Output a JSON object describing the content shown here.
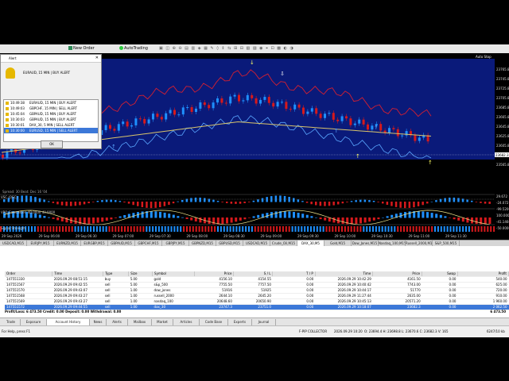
{
  "toolbar": {
    "new_order": "New Order",
    "auto_trading": "AutoTrading"
  },
  "alert": {
    "title": "Alert",
    "message": "EURAUD, 15 MIN | BUY ALERT",
    "items": [
      {
        "time": "10:49:38",
        "text": "EURAUD, 15 MIN | BUY ALERT"
      },
      {
        "time": "10:49:03",
        "text": "GBPCHF, 15 MIN | SELL ALERT"
      },
      {
        "time": "10:45:04",
        "text": "GBPAUD, 15 MIN | BUY ALERT"
      },
      {
        "time": "10:30:03",
        "text": "GBPAUD, 15 MIN | BUY ALERT"
      },
      {
        "time": "10:30:01",
        "text": "DAX_30, 5 MIN | SELL ALERT"
      },
      {
        "time": "10:30:00",
        "text": "EURUSD, 15 MIN | SELL ALERT"
      }
    ],
    "ok": "OK"
  },
  "chart": {
    "auto_stop": "Auto Stop",
    "spread_text": "Spread: 30  Beat: Dec 16 '04",
    "indicator1": "VSC (OSC)",
    "indicator2": "VPO_Forecaster: 40.0000 40.0000",
    "indicator3": "Signal Strength",
    "price_labels": [
      "23765.8",
      "23745.8",
      "23725.8",
      "23705.8",
      "23685.8",
      "23665.8",
      "23645.8",
      "23625.8",
      "23605.8",
      "23585.8",
      "23565.8"
    ],
    "osc_labels": [
      "29.672",
      "-24.072",
      "-99.5200",
      "100.000",
      "-41.1460",
      "-50.0000"
    ],
    "time_labels": [
      "29 Sep 2026",
      "29 Sep 06:00",
      "29 Sep 06:30",
      "29 Sep 07:00",
      "29 Sep 07:30",
      "29 Sep 08:00",
      "29 Sep 08:30",
      "29 Sep 09:00",
      "29 Sep 09:30",
      "29 Sep 10:00",
      "29 Sep 10:30",
      "29 Sep 11:00",
      "29 Sep 11:30"
    ],
    "current_price": "23682.3"
  },
  "symbol_tabs": [
    "USDCAD,M15",
    "EURJPY,M15",
    "EURNZD,M15",
    "EURGBP,M15",
    "GBPAUD,M15",
    "GBPCHF,M15",
    "GBPJPY,M15",
    "GBPNZD,M15",
    "GBPUSD,M15",
    "USDCAD,M15",
    "Crude_Oil,M15",
    "DAX_30,M5",
    "Gold,M15",
    "Dow_Jones,M15",
    "Nasdaq_100,M15",
    "Russell_2000,M15",
    "S&P_500,M15"
  ],
  "orders": {
    "columns": [
      "Order",
      "Time",
      "Type",
      "Size",
      "Symbol",
      "Price",
      "S / L",
      "T / P",
      "Time",
      "Price",
      "Swap",
      "Profit"
    ],
    "rows": [
      [
        "147551330",
        "2026.09.29 08:51:15",
        "buy",
        "5.00",
        "gold",
        "4156.10",
        "4154.55",
        "0.00",
        "2026.09.29 10:42:29",
        "4161.50",
        "0.00",
        "540.00"
      ],
      [
        "147551567",
        "2026.09.29 09:42:55",
        "sell",
        "5.00",
        "s&p_500",
        "7755.50",
        "7757.50",
        "0.00",
        "2026.09.29 10:40:42",
        "7743.00",
        "0.00",
        "625.00"
      ],
      [
        "147551570",
        "2026.09.29 09:43:07",
        "sell",
        "1.00",
        "dow_jones",
        "51916",
        "51925",
        "0.00",
        "2026.09.29 10:44:17",
        "51770",
        "0.00",
        "720.00"
      ],
      [
        "147551568",
        "2026.09.29 09:43:27",
        "sell",
        "1.00",
        "russell_2000",
        "2644.10",
        "2645.20",
        "0.00",
        "2026.09.29 11:27:44",
        "2635.00",
        "0.00",
        "910.00"
      ],
      [
        "147551569",
        "2026.09.29 09:43:27",
        "sell",
        "1.00",
        "nasdaq_100",
        "20648.60",
        "20650.90",
        "0.00",
        "2026.09.29 10:45:13",
        "20571.20",
        "0.00",
        "1 960.00"
      ],
      [
        "147551572",
        "2026.09.29 09:44:55",
        "sell",
        "1.00",
        "dax_30",
        "23747.3",
        "23751.0",
        "0.00",
        "2026.09.29 10:18:07",
        "23682.3",
        "0.00",
        "2 062.50"
      ]
    ],
    "summary": "Profit/Loss: 6 473.50  Credit: 0.00  Deposit: 0.00  Withdrawal: 0.00",
    "summary_total": "6 473.50"
  },
  "bottom_tabs": [
    "Trade",
    "Exposure",
    "Account History",
    "News",
    "Alerts",
    "Mailbox",
    "Market",
    "Articles",
    "Code Base",
    "Experts",
    "Journal"
  ],
  "status": {
    "help": "For Help, press F1",
    "profile": "F-PIP COLLECTOR",
    "datetime": "2026.09.29 10:20",
    "ohlc": "O: 23694.4   H: 23698.8   L: 23670.6   C: 23682.3   V: 165",
    "traffic": "6247/10 kb"
  },
  "colors": {
    "chart_bg": "#000000",
    "plot_bg": "#0a1a7a",
    "bull": "#1e90ff",
    "bear": "#d7191c",
    "band": "#d61f30",
    "ma": "#d9c46a",
    "trail": "#5aa6ff"
  }
}
